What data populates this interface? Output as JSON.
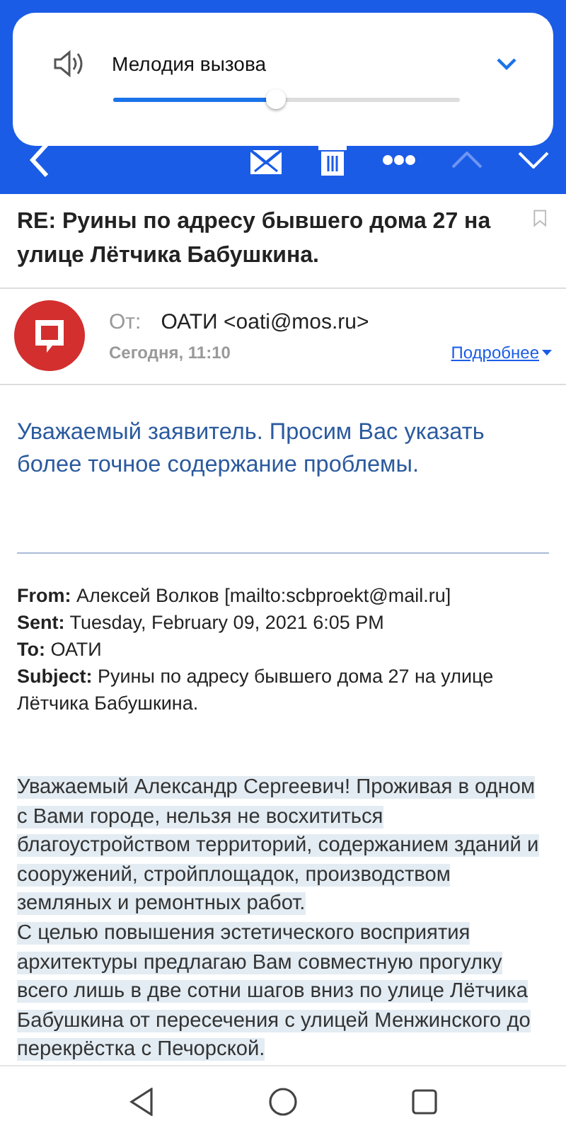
{
  "volume_panel": {
    "label": "Мелодия вызова",
    "level": 0.47
  },
  "toolbar": {
    "up_disabled": true
  },
  "message": {
    "subject": "RE: Руины по адресу бывшего дома 27 на улице Лётчика Бабушкина.",
    "from_label": "От:",
    "from": "ОАТИ <oati@mos.ru>",
    "date": "Сегодня, 11:10",
    "details_link": "Подробнее",
    "reply": "Уважаемый заявитель. Просим Вас указать более точное содержание проблемы.",
    "quoted_headers": [
      {
        "label": "From:",
        "value": "Алексей Волков [mailto:scbproekt@mail.ru]"
      },
      {
        "label": "Sent:",
        "value": "Tuesday, February 09, 2021 6:05 PM"
      },
      {
        "label": "To:",
        "value": "ОАТИ"
      },
      {
        "label": "Subject:",
        "value": "Руины по адресу бывшего дома 27 на улице Лётчика Бабушкина."
      }
    ],
    "body": [
      "Уважаемый Александр Сергеевич! Проживая в одном с Вами городе, нельзя не восхититься благоустройством территорий, содержанием зданий и сооружений, стройплощадок, производством земляных и ремонтных работ.",
      "С целью повышения эстетического восприятия архитектуры предлагаю Вам совместную прогулку всего лишь в две сотни шагов вниз по улице Лётчика Бабушкина от пересечения с улицей Менжинского до перекрёстка с Печорской."
    ]
  }
}
